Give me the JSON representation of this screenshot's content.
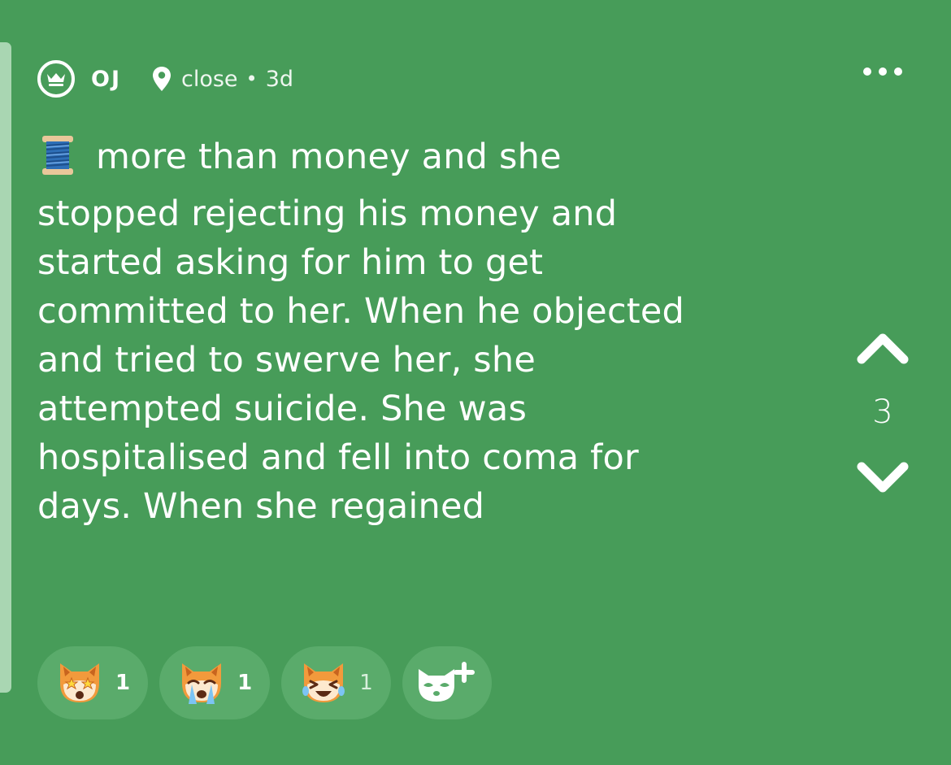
{
  "post": {
    "author": "OJ",
    "location": "close",
    "separator": "•",
    "age": "3d",
    "body_lines": [
      "more than money and she",
      "stopped rejecting his money and",
      "started asking for him to get",
      "committed to her. When he objected",
      "and tried to swerve her, she",
      "attempted suicide. She was",
      "hospitalised and fell into coma for",
      "days. When she regained"
    ],
    "leading_icon": "thread-spool-icon",
    "vote_count": "3"
  },
  "reactions": [
    {
      "icon": "star-eyes-fox-icon",
      "count": "1"
    },
    {
      "icon": "crying-fox-icon",
      "count": "1"
    },
    {
      "icon": "laughing-fox-icon",
      "count": "1"
    }
  ],
  "add_reaction_icon": "add-reaction-icon",
  "colors": {
    "background": "#479c59",
    "pill": "#5aab6b",
    "left_bar": "#a9d6b2",
    "text": "#ffffff"
  }
}
